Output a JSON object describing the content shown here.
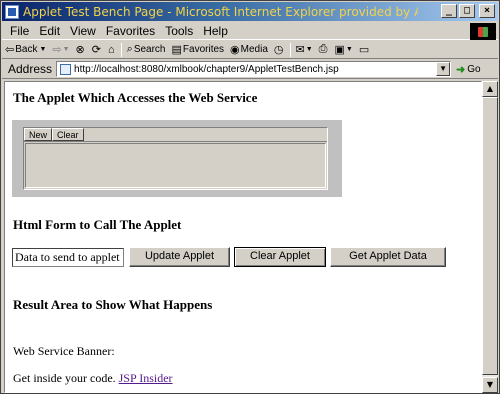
{
  "window": {
    "title": "Applet Test Bench Page - Microsoft Internet Explorer provided by AT&T WorldNet"
  },
  "menu": [
    "File",
    "Edit",
    "View",
    "Favorites",
    "Tools",
    "Help"
  ],
  "toolbar": {
    "back": "Back",
    "search": "Search",
    "favorites": "Favorites",
    "media": "Media"
  },
  "address": {
    "label": "Address",
    "url": "http://localhost:8080/xmlbook/chapter9/AppletTestBench.jsp",
    "go": "Go"
  },
  "page": {
    "heading_applet": "The Applet Which Accesses the Web Service",
    "applet_tabs": [
      "New",
      "Clear"
    ],
    "heading_form": "Html Form to Call The Applet",
    "input_value": "Data to send to applet",
    "buttons": {
      "update": "Update Applet",
      "clear": "Clear Applet",
      "get": "Get Applet Data"
    },
    "heading_result": "Result Area to Show What Happens",
    "banner_label": "Web Service Banner:",
    "inside_text": "Get inside your code.",
    "inside_link": "JSP Insider"
  }
}
